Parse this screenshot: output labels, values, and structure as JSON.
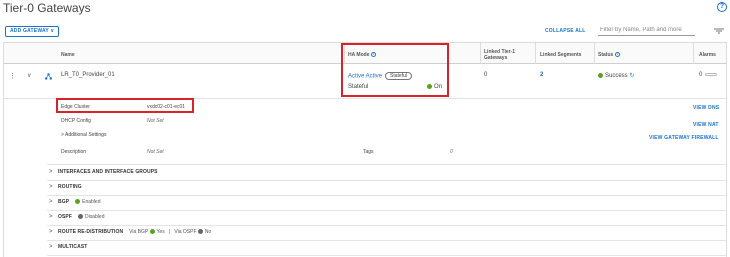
{
  "page": {
    "title": "Tier-0 Gateways"
  },
  "toolbar": {
    "add_gateway": "ADD GATEWAY ∨",
    "collapse_all": "COLLAPSE ALL",
    "filter_placeholder": "Filter by Name, Path and more"
  },
  "table": {
    "headers": {
      "name": "Name",
      "ha_mode": "HA Mode",
      "linked_tier1": "Linked Tier-1 Gateways",
      "linked_segments": "Linked Segments",
      "status": "Status",
      "alarms": "Alarms"
    },
    "row": {
      "name": "LR_T0_Provider_01",
      "ha_mode": "Active Active",
      "ha_badge": "Stateful",
      "stateful_label": "Stateful",
      "stateful_value": "On",
      "linked_tier1": "0",
      "linked_segments": "2",
      "status": "Success",
      "alarms": "0"
    }
  },
  "details": {
    "edge_cluster_label": "Edge Cluster",
    "edge_cluster_value": "vxdc02-c01-ec01",
    "dhcp_label": "DHCP Config",
    "dhcp_value": "Not Set",
    "additional_settings": "Additional Settings",
    "description_label": "Description",
    "description_value": "Not Set",
    "tags_label": "Tags",
    "tags_value": "0",
    "view_dns": "VIEW DNS",
    "view_nat": "VIEW NAT",
    "view_firewall": "VIEW GATEWAY FIREWALL"
  },
  "sections": {
    "interfaces": "INTERFACES AND INTERFACE GROUPS",
    "routing": "ROUTING",
    "bgp": "BGP",
    "bgp_status": "Enabled",
    "ospf": "OSPF",
    "ospf_status": "Disabled",
    "route_redistribution": "ROUTE RE-DISTRIBUTION",
    "via_bgp_label": "Via BGP",
    "via_bgp_value": "Yes",
    "via_ospf_label": "Via OSPF",
    "via_ospf_value": "No",
    "multicast": "MULTICAST"
  },
  "colors": {
    "accent": "#1a73c8",
    "success": "#5aa220",
    "highlight": "#d9232a"
  }
}
